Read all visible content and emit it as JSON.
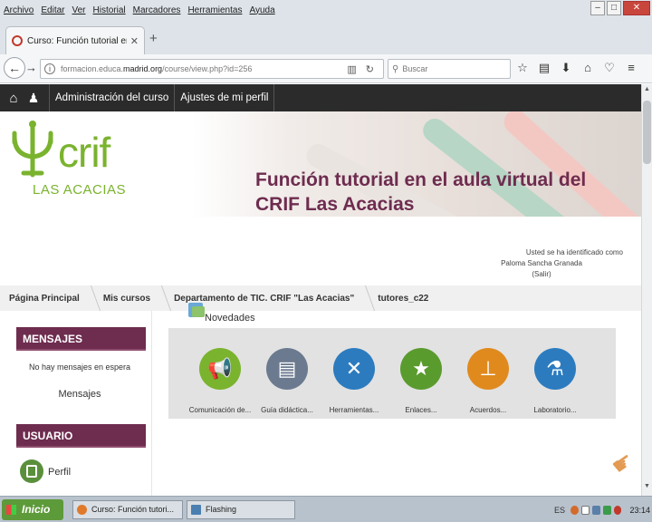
{
  "browser": {
    "menu": [
      "Archivo",
      "Editar",
      "Ver",
      "Historial",
      "Marcadores",
      "Herramientas",
      "Ayuda"
    ],
    "tab_title": "Curso: Función tutorial en el ...",
    "url_host": "formacion.educa.",
    "url_bold": "madrid.org",
    "url_path": "/course/view.php?id=256",
    "search_placeholder": "Buscar"
  },
  "topnav": {
    "admin": "Administración del curso",
    "profile": "Ajustes de mi perfil"
  },
  "logo": {
    "crif": "crif",
    "acacias": "LAS ACACIAS"
  },
  "site_title": "Función tutorial en el aula virtual del CRIF Las Acacias",
  "login": {
    "line1": "Usted se ha identificado como",
    "name": "Paloma Sancha Granada",
    "logout": "(Salir)"
  },
  "breadcrumb": [
    "Página Principal",
    "Mis cursos",
    "Departamento de TIC. CRIF \"Las Acacias\"",
    "tutores_c22"
  ],
  "blocks": {
    "messages_title": "MENSAJES",
    "no_messages": "No hay mensajes en espera",
    "messages_link": "Mensajes",
    "user_title": "USUARIO",
    "profile_link": "Perfil"
  },
  "news_title": "Novedades",
  "course_icons": [
    {
      "color": "#7ab32e",
      "icon": "megaphone-icon",
      "label": "Comunicación de..."
    },
    {
      "color": "#6b7a8f",
      "icon": "notebook-icon",
      "label": "Guía didáctica..."
    },
    {
      "color": "#2c7bbf",
      "icon": "tools-icon",
      "label": "Herramientas..."
    },
    {
      "color": "#5a9b2e",
      "icon": "star-icon",
      "label": "Enlaces..."
    },
    {
      "color": "#e08a1e",
      "icon": "stamp-icon",
      "label": "Acuerdos..."
    },
    {
      "color": "#2c7bbf",
      "icon": "flask-icon",
      "label": "Laboratorio..."
    }
  ],
  "taskbar": {
    "start": "Inicio",
    "task1": "Curso: Función tutori...",
    "task2": "Flashing",
    "lang": "ES",
    "clock": "23:14"
  }
}
